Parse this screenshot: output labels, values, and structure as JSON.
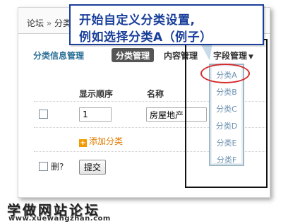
{
  "breadcrumb": {
    "part1": "论坛",
    "separator": "»",
    "part2": "分类"
  },
  "section_title": "分类信息管理",
  "tabs": {
    "active": "分类管理",
    "content": "内容管理",
    "field": "字段管理",
    "field_caret": "▼"
  },
  "table": {
    "col_order": "显示顺序",
    "col_name": "名称",
    "row": {
      "order_value": "1",
      "name_value": "房屋地产"
    }
  },
  "add_category": {
    "icon": "+",
    "label": "添加分类"
  },
  "footer": {
    "delete_label": "删?",
    "submit_label": "提交"
  },
  "dropdown_items": [
    "分类A",
    "分类B",
    "分类C",
    "分类D",
    "分类E",
    "分类F"
  ],
  "callout": {
    "line1": "开始自定义分类设置,",
    "line2": "例如选择分类A（例子）"
  },
  "watermark": {
    "title": "学做网站论坛",
    "url": "www.xuewangzhan.com"
  },
  "colors": {
    "callout_text": "#1a3f9a",
    "highlight": "#d62b2b",
    "section_title": "#2a6e96",
    "add_link": "#e07b00"
  }
}
